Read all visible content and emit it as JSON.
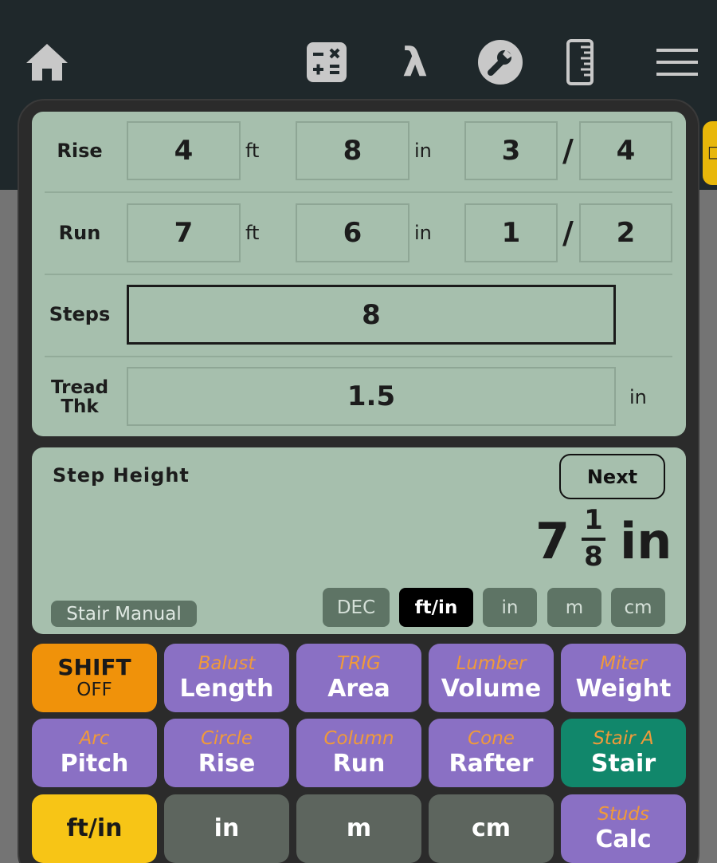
{
  "stair_inputs": {
    "rise": {
      "label": "Rise",
      "ft": "4",
      "ft_unit": "ft",
      "in": "8",
      "in_unit": "in",
      "num": "3",
      "slash": "/",
      "den": "4"
    },
    "run": {
      "label": "Run",
      "ft": "7",
      "ft_unit": "ft",
      "in": "6",
      "in_unit": "in",
      "num": "1",
      "slash": "/",
      "den": "2"
    },
    "steps": {
      "label": "Steps",
      "value": "8"
    },
    "tread": {
      "label_line1": "Tread",
      "label_line2": "Thk",
      "value": "1.5",
      "unit": "in"
    }
  },
  "result": {
    "label": "Step Height",
    "next_label": "Next",
    "whole": "7",
    "numerator": "1",
    "denominator": "8",
    "unit": "in",
    "mode_badge": "Stair Manual",
    "unit_options": [
      "DEC",
      "ft/in",
      "in",
      "m",
      "cm"
    ],
    "selected_unit": "ft/in"
  },
  "keypad": {
    "row1": [
      {
        "sec": "",
        "pri": "SHIFT",
        "sub": "OFF",
        "color": "orange"
      },
      {
        "sec": "Balust",
        "pri": "Length",
        "color": "purple"
      },
      {
        "sec": "TRIG",
        "pri": "Area",
        "color": "purple"
      },
      {
        "sec": "Lumber",
        "pri": "Volume",
        "color": "purple"
      },
      {
        "sec": "Miter",
        "pri": "Weight",
        "color": "purple"
      }
    ],
    "row2": [
      {
        "sec": "Arc",
        "pri": "Pitch",
        "color": "purple"
      },
      {
        "sec": "Circle",
        "pri": "Rise",
        "color": "purple"
      },
      {
        "sec": "Column",
        "pri": "Run",
        "color": "purple"
      },
      {
        "sec": "Cone",
        "pri": "Rafter",
        "color": "purple"
      },
      {
        "sec": "Stair A",
        "pri": "Stair",
        "color": "green"
      }
    ],
    "row3": [
      {
        "sec": "",
        "pri": "ft/in",
        "color": "yellow"
      },
      {
        "sec": "",
        "pri": "in",
        "color": "darkgray"
      },
      {
        "sec": "",
        "pri": "m",
        "color": "darkgray"
      },
      {
        "sec": "",
        "pri": "cm",
        "color": "darkgray"
      },
      {
        "sec": "Studs",
        "pri": "Calc",
        "color": "purple"
      }
    ]
  },
  "nav": {
    "icons": [
      "home-icon",
      "calculator-icon",
      "lambda-icon",
      "wrench-icon",
      "ruler-icon",
      "menu-icon"
    ],
    "lambda_glyph": "λ"
  },
  "colors": {
    "topbar": "#1f282b",
    "panel": "#a6bfad",
    "purple_key": "#8a70c4",
    "orange_key": "#f0920a",
    "green_key": "#11876b",
    "yellow_key": "#f7c516",
    "secondary_label": "#f09a3a"
  }
}
